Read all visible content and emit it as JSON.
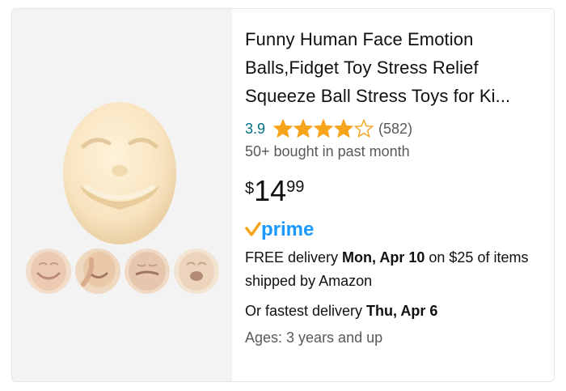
{
  "product": {
    "title": "Funny Human Face Emotion Balls,Fidget Toy Stress Relief Squeeze Ball Stress Toys for Ki...",
    "rating_value": "3.9",
    "rating_stars": 3.9,
    "review_count": "(582)",
    "bought_text": "50+ bought in past month",
    "price": {
      "symbol": "$",
      "whole": "14",
      "fraction": "99"
    },
    "prime_label": "prime",
    "delivery": {
      "prefix": "FREE delivery ",
      "date": "Mon, Apr 10",
      "suffix": " on $25 of items shipped by Amazon"
    },
    "fastest": {
      "prefix": "Or fastest delivery ",
      "date": "Thu, Apr 6"
    },
    "ages": "Ages: 3 years and up"
  },
  "media": {
    "main_image": "smiling-face-ball",
    "thumbnails": [
      "face-ball-variant-1",
      "face-ball-variant-2",
      "face-ball-variant-3",
      "face-ball-variant-4"
    ]
  },
  "colors": {
    "star": "#f7a41d",
    "rating_link": "#007185",
    "prime_blue": "#1a98ff",
    "prime_check": "#f7a41d"
  }
}
